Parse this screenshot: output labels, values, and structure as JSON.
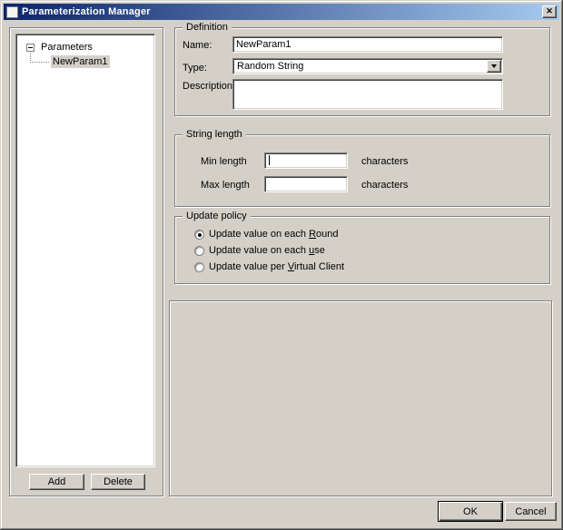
{
  "window": {
    "title": "Parameterization Manager",
    "close_glyph": "✕"
  },
  "tree": {
    "root_label": "Parameters",
    "child_label": "NewParam1"
  },
  "tree_buttons": {
    "add_label": "Add",
    "delete_label": "Delete"
  },
  "definition": {
    "caption": "Definition",
    "name_label": "Name:",
    "name_value": "NewParam1",
    "type_label": "Type:",
    "type_value": "Random String",
    "description_label": "Description",
    "description_value": ""
  },
  "string_length": {
    "caption": "String length",
    "min_label": "Min length",
    "min_value": "",
    "min_unit": "characters",
    "max_label": "Max length",
    "max_value": "",
    "max_unit": "characters"
  },
  "update_policy": {
    "caption": "Update policy",
    "options": [
      {
        "pre": "Update value on each ",
        "mnemonic": "R",
        "post": "ound",
        "selected": true
      },
      {
        "pre": "Update value on each ",
        "mnemonic": "u",
        "post": "se",
        "selected": false
      },
      {
        "pre": "Update value per ",
        "mnemonic": "V",
        "post": "irtual Client",
        "selected": false
      }
    ]
  },
  "footer": {
    "ok_label": "OK",
    "cancel_label": "Cancel"
  },
  "colors": {
    "titlebar_start": "#0a246a",
    "titlebar_end": "#a6caf0",
    "face": "#d4d0c8",
    "inactive_selection": "#d4d0c8"
  }
}
